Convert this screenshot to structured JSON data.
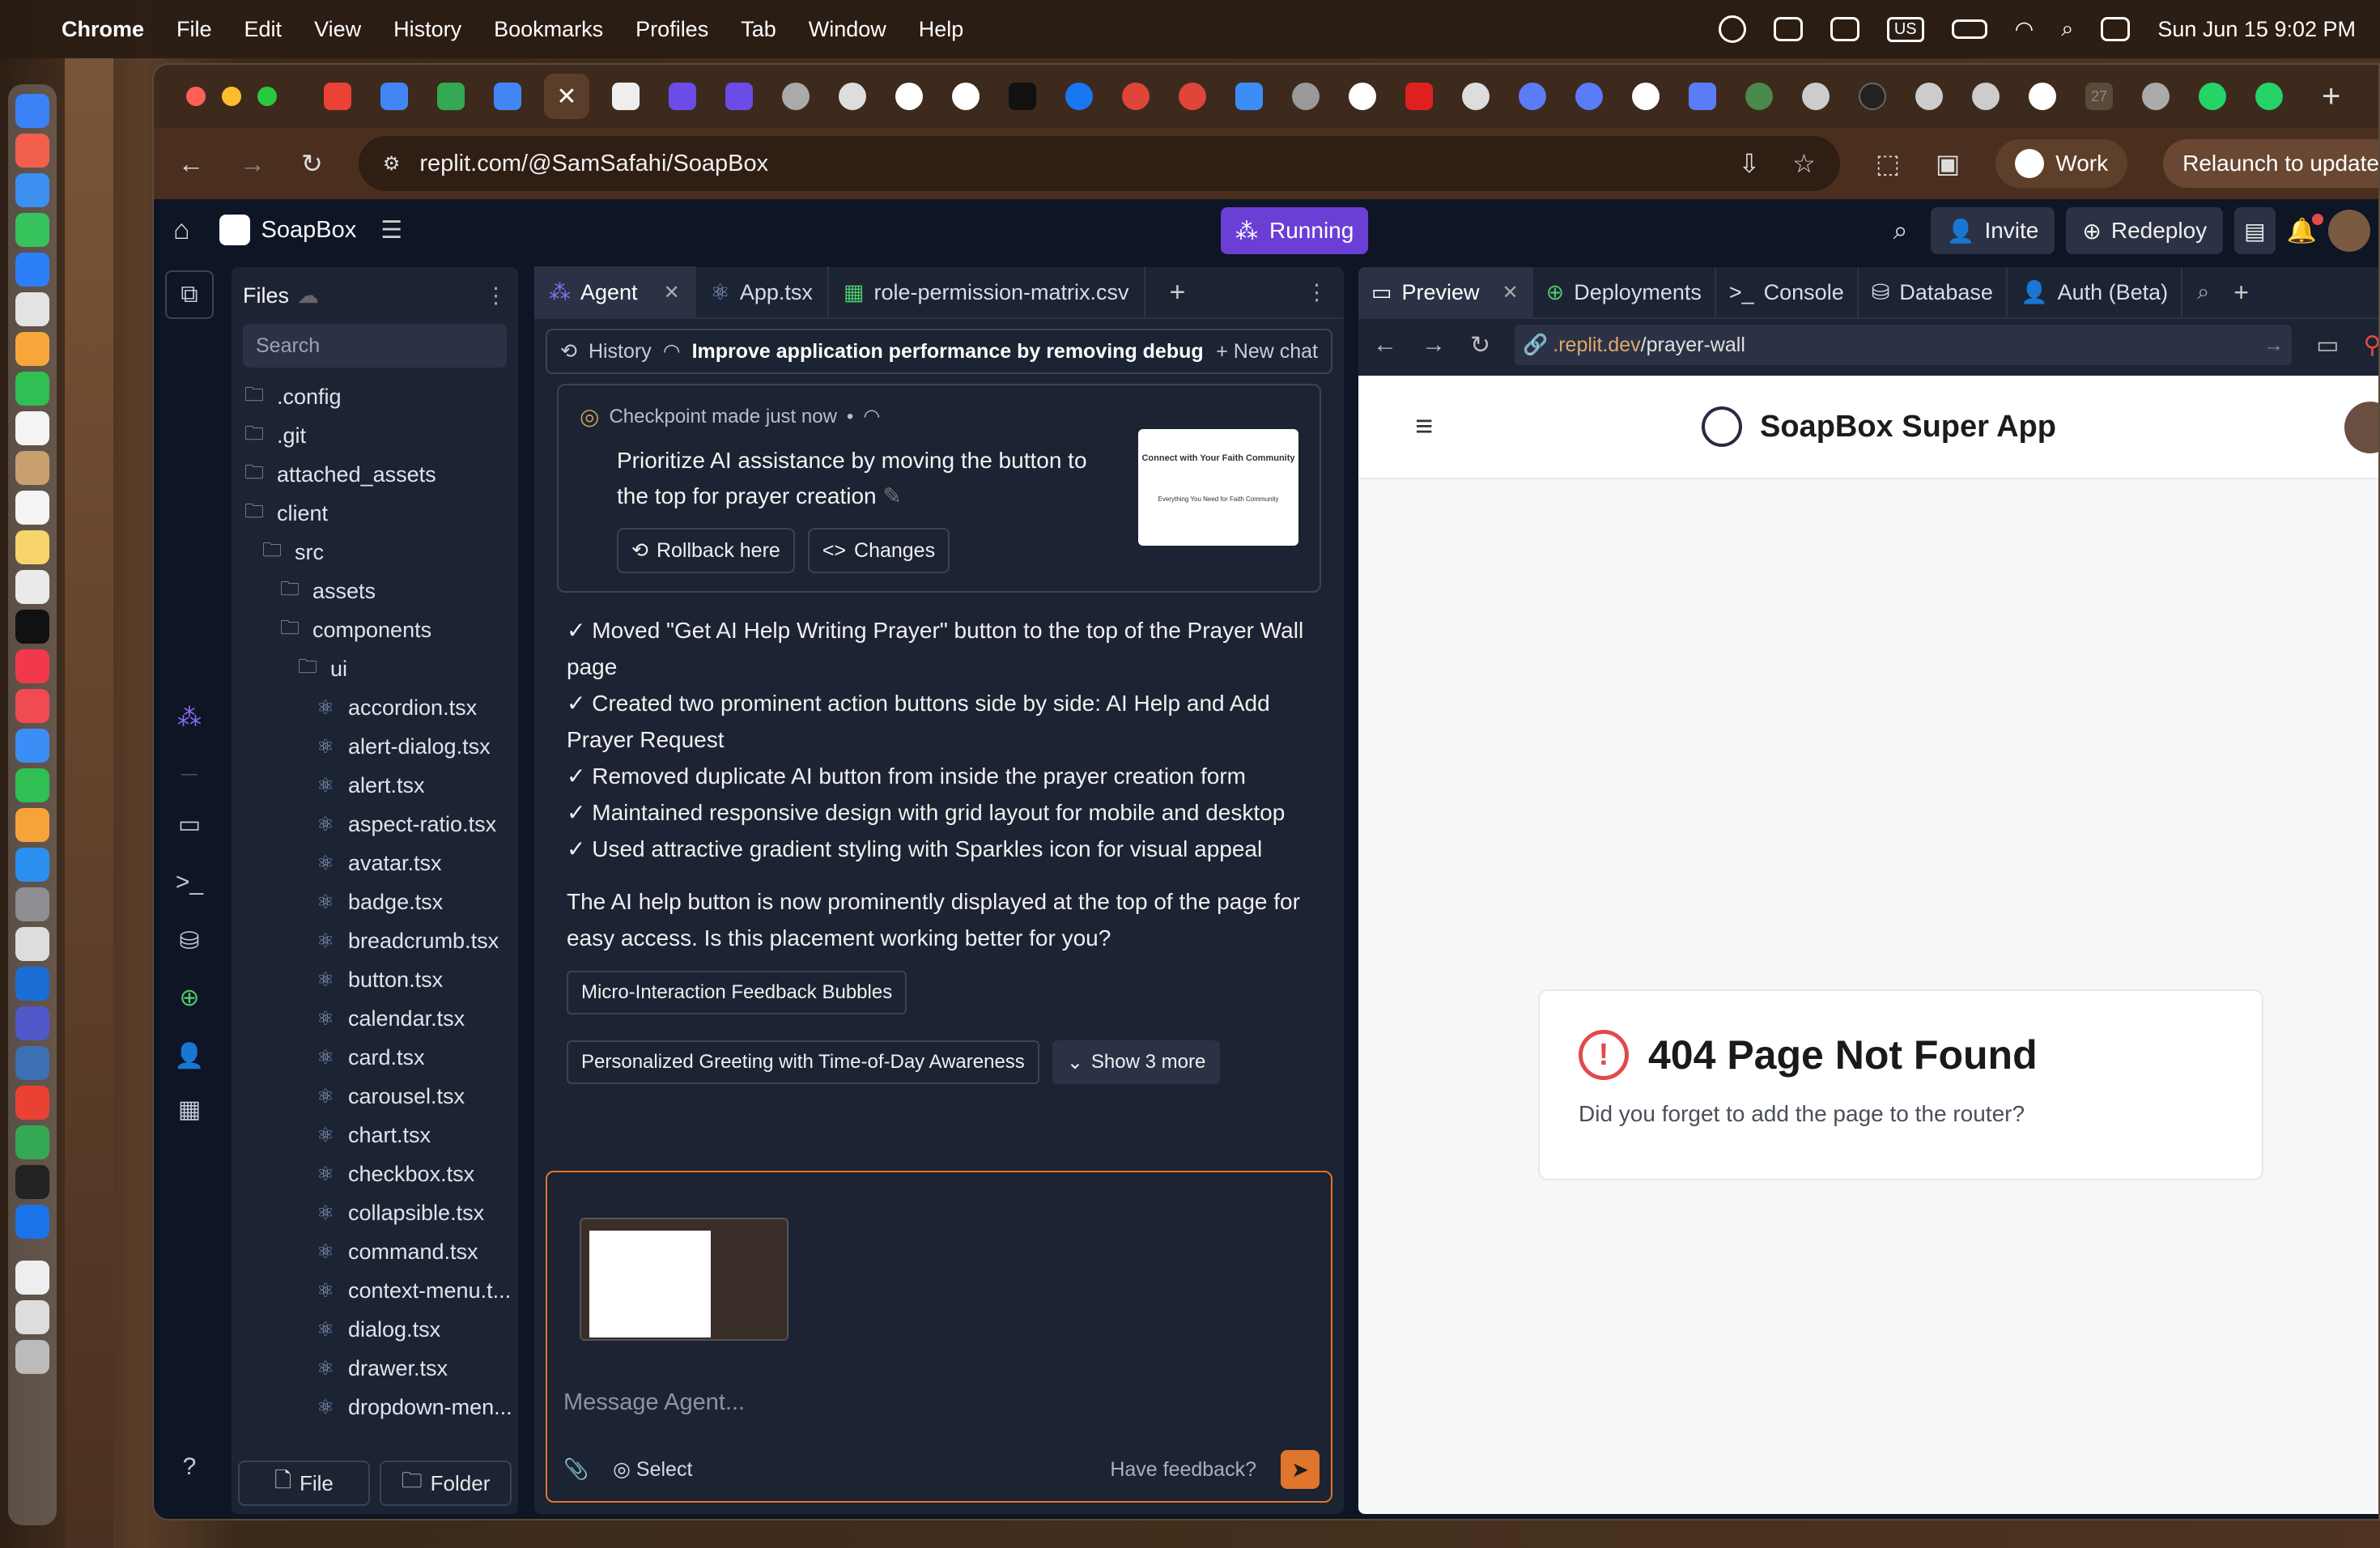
{
  "menubar": {
    "app": "Chrome",
    "items": [
      "File",
      "Edit",
      "View",
      "History",
      "Bookmarks",
      "Profiles",
      "Tab",
      "Window",
      "Help"
    ],
    "keyboard": "US",
    "datetime": "Sun Jun 15  9:02 PM"
  },
  "browser": {
    "url": "replit.com/@SamSafahi/SoapBox",
    "profile_label": "Work",
    "relaunch_label": "Relaunch to update",
    "tab_badge": "27"
  },
  "replit": {
    "project_name": "SoapBox",
    "run_status": "Running",
    "invite_label": "Invite",
    "redeploy_label": "Redeploy",
    "notification_count": "1"
  },
  "files": {
    "title": "Files",
    "search_placeholder": "Search",
    "tree": [
      {
        "name": ".config",
        "type": "folder",
        "depth": 0
      },
      {
        "name": ".git",
        "type": "folder",
        "depth": 0
      },
      {
        "name": "attached_assets",
        "type": "folder",
        "depth": 0
      },
      {
        "name": "client",
        "type": "folder",
        "depth": 0
      },
      {
        "name": "src",
        "type": "folder",
        "depth": 1
      },
      {
        "name": "assets",
        "type": "folder",
        "depth": 2
      },
      {
        "name": "components",
        "type": "folder",
        "depth": 2
      },
      {
        "name": "ui",
        "type": "folder",
        "depth": 3
      },
      {
        "name": "accordion.tsx",
        "type": "file",
        "depth": 4
      },
      {
        "name": "alert-dialog.tsx",
        "type": "file",
        "depth": 4
      },
      {
        "name": "alert.tsx",
        "type": "file",
        "depth": 4
      },
      {
        "name": "aspect-ratio.tsx",
        "type": "file",
        "depth": 4
      },
      {
        "name": "avatar.tsx",
        "type": "file",
        "depth": 4
      },
      {
        "name": "badge.tsx",
        "type": "file",
        "depth": 4
      },
      {
        "name": "breadcrumb.tsx",
        "type": "file",
        "depth": 4
      },
      {
        "name": "button.tsx",
        "type": "file",
        "depth": 4
      },
      {
        "name": "calendar.tsx",
        "type": "file",
        "depth": 4
      },
      {
        "name": "card.tsx",
        "type": "file",
        "depth": 4
      },
      {
        "name": "carousel.tsx",
        "type": "file",
        "depth": 4
      },
      {
        "name": "chart.tsx",
        "type": "file",
        "depth": 4
      },
      {
        "name": "checkbox.tsx",
        "type": "file",
        "depth": 4
      },
      {
        "name": "collapsible.tsx",
        "type": "file",
        "depth": 4
      },
      {
        "name": "command.tsx",
        "type": "file",
        "depth": 4
      },
      {
        "name": "context-menu.t...",
        "type": "file",
        "depth": 4
      },
      {
        "name": "dialog.tsx",
        "type": "file",
        "depth": 4
      },
      {
        "name": "drawer.tsx",
        "type": "file",
        "depth": 4
      },
      {
        "name": "dropdown-men...",
        "type": "file",
        "depth": 4
      }
    ],
    "new_file_label": "File",
    "new_folder_label": "Folder"
  },
  "agent": {
    "tabs": [
      {
        "label": "Agent",
        "active": true
      },
      {
        "label": "App.tsx",
        "active": false
      },
      {
        "label": "role-permission-matrix.csv",
        "active": false
      }
    ],
    "history_label": "History",
    "chat_title": "Improve application performance by removing debug...",
    "new_chat_label": "New chat",
    "checkpoint": {
      "status": "Checkpoint made just now",
      "description": "Prioritize AI assistance by moving the button to the top for prayer creation",
      "rollback_label": "Rollback here",
      "changes_label": "Changes",
      "thumb_title": "Connect with Your Faith Community",
      "thumb_sub": "Everything You Need for Faith Community"
    },
    "bullets": [
      "✓ Moved \"Get AI Help Writing Prayer\" button to the top of the Prayer Wall page",
      "✓ Created two prominent action buttons side by side: AI Help and Add Prayer Request",
      "✓ Removed duplicate AI button from inside the prayer creation form",
      "✓ Maintained responsive design with grid layout for mobile and desktop",
      "✓ Used attractive gradient styling with Sparkles icon for visual appeal"
    ],
    "message": "The AI help button is now prominently displayed at the top of the page for easy access. Is this placement working better for you?",
    "suggestions": [
      "Micro-Interaction Feedback Bubbles",
      "Personalized Greeting with Time-of-Day Awareness"
    ],
    "show_more_label": "Show 3 more",
    "composer_placeholder": "Message Agent...",
    "select_label": "Select",
    "feedback_label": "Have feedback?"
  },
  "preview": {
    "tabs": [
      "Preview",
      "Deployments",
      "Console",
      "Database",
      "Auth (Beta)"
    ],
    "url_domain": ".replit.dev",
    "url_path": "/prayer-wall",
    "app_name": "SoapBox Super App",
    "error_title": "404 Page Not Found",
    "error_message": "Did you forget to add the page to the router?"
  },
  "colors": {
    "replit_bg": "#0e1525",
    "panel_bg": "#1c2333",
    "running": "#6b3fd6",
    "accent_orange": "#e0752d",
    "error_red": "#e24a4a"
  }
}
